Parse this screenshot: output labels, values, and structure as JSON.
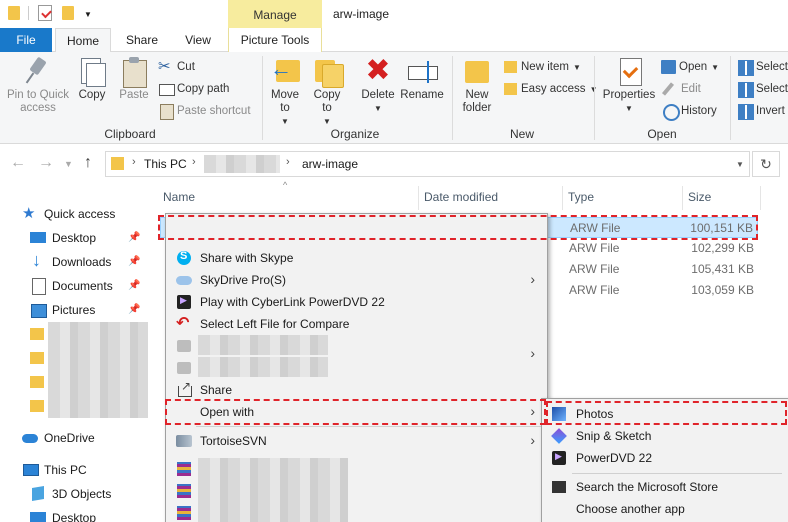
{
  "window": {
    "title": "arw-image",
    "contextual_tab_group": "Manage"
  },
  "tabs": {
    "file": "File",
    "home": "Home",
    "share": "Share",
    "view": "View",
    "picture_tools": "Picture Tools"
  },
  "ribbon": {
    "clipboard": {
      "group_label": "Clipboard",
      "pin_label": "Pin to Quick access",
      "copy_label": "Copy",
      "paste_label": "Paste",
      "cut_label": "Cut",
      "copy_path_label": "Copy path",
      "paste_shortcut_label": "Paste shortcut"
    },
    "organize": {
      "group_label": "Organize",
      "move_to_label": "Move to",
      "copy_to_label": "Copy to",
      "delete_label": "Delete",
      "rename_label": "Rename"
    },
    "new": {
      "group_label": "New",
      "new_folder_label": "New folder",
      "new_item_label": "New item",
      "easy_access_label": "Easy access"
    },
    "open": {
      "group_label": "Open",
      "properties_label": "Properties",
      "open_label": "Open",
      "edit_label": "Edit",
      "history_label": "History"
    },
    "select": {
      "select_all_label": "Select",
      "select_none_label": "Select",
      "invert_label": "Invert"
    }
  },
  "address": {
    "segments": [
      "This PC",
      "arw-image"
    ]
  },
  "columns": {
    "name": "Name",
    "date_modified": "Date modified",
    "type": "Type",
    "size": "Size"
  },
  "nav": {
    "quick_access": "Quick access",
    "desktop": "Desktop",
    "downloads": "Downloads",
    "documents": "Documents",
    "pictures": "Pictures",
    "onedrive": "OneDrive",
    "this_pc": "This PC",
    "objects_3d": "3D Objects",
    "desktop2": "Desktop"
  },
  "files": [
    {
      "type": "ARW File",
      "size": "100,151 KB"
    },
    {
      "type": "ARW File",
      "size": "102,299 KB"
    },
    {
      "type": "ARW File",
      "size": "105,431 KB"
    },
    {
      "type": "ARW File",
      "size": "103,059 KB"
    }
  ],
  "context_menu": {
    "share_skype": "Share with Skype",
    "skydrive": "SkyDrive Pro(S)",
    "powerdvd": "Play with CyberLink PowerDVD 22",
    "compare": "Select Left File for Compare",
    "share": "Share",
    "open_with": "Open with",
    "tortoisesvn": "TortoiseSVN"
  },
  "open_with_submenu": {
    "photos": "Photos",
    "snip": "Snip & Sketch",
    "powerdvd": "PowerDVD 22",
    "store": "Search the Microsoft Store",
    "choose": "Choose another app"
  },
  "colors": {
    "file_tab": "#1979ca",
    "manage_tab": "#f7ec9e",
    "selection": "#cce8ff",
    "highlight": "#e0242a"
  }
}
